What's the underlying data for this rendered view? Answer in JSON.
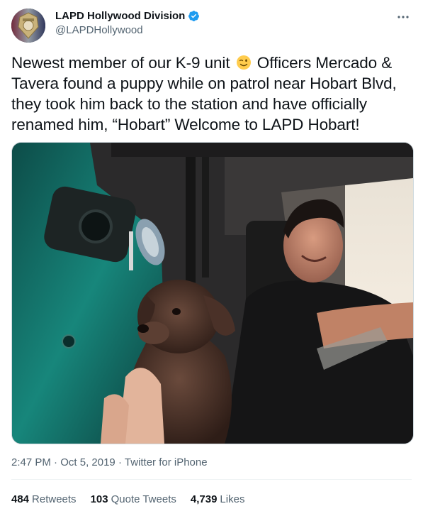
{
  "account": {
    "display_name": "LAPD Hollywood Division",
    "handle": "@LAPDHollywood",
    "verified": true
  },
  "icons": {
    "avatar": "lapd-badge-icon",
    "verified": "verified-badge-icon",
    "more": "more-horizontal-icon",
    "emoji": "winking-face-emoji"
  },
  "tweet": {
    "text_before_emoji": "Newest member of our K-9 unit",
    "text_after_emoji": "Officers Mercado & Tavera found a puppy while on patrol near Hobart Blvd, they took him back to the station and have officially renamed him, “Hobart” Welcome to LAPD Hobart!"
  },
  "meta": {
    "time": "2:47 PM",
    "separator": "·",
    "date": "Oct 5, 2019",
    "source": "Twitter for iPhone"
  },
  "stats": {
    "retweets_count": "484",
    "retweets_label": "Retweets",
    "quotes_count": "103",
    "quotes_label": "Quote Tweets",
    "likes_count": "4,739",
    "likes_label": "Likes"
  },
  "colors": {
    "text": "#0f1419",
    "secondary": "#536471",
    "verified": "#1d9bf0",
    "border": "#eff3f4"
  }
}
